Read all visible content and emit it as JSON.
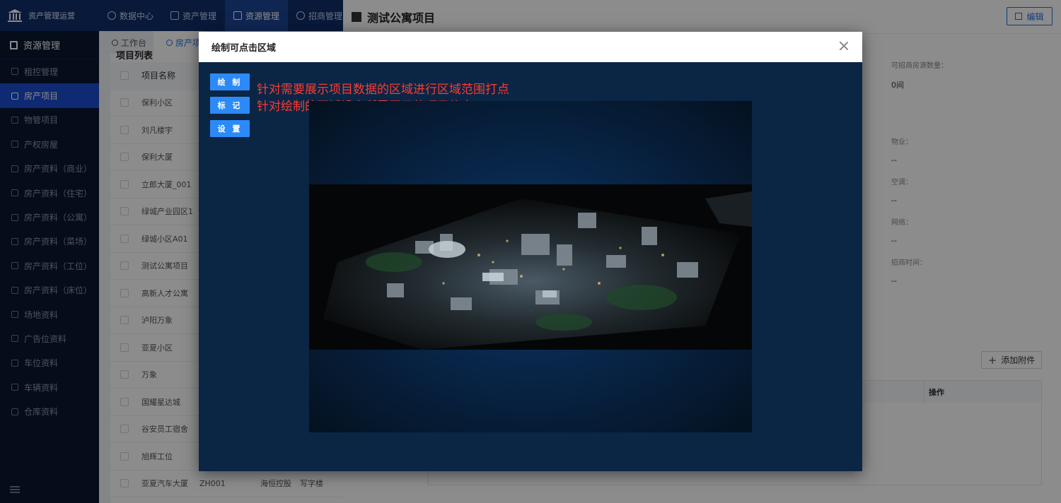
{
  "app": {
    "name": "资产管理运营"
  },
  "topnav": [
    {
      "label": "数据中心",
      "active": false
    },
    {
      "label": "资产管理",
      "active": false
    },
    {
      "label": "资源管理",
      "active": true
    },
    {
      "label": "招商管理",
      "active": false
    }
  ],
  "sidebar": {
    "header": "资源管理",
    "items": [
      {
        "label": "租控管理",
        "active": false
      },
      {
        "label": "房产项目",
        "active": true
      },
      {
        "label": "物管项目",
        "active": false
      },
      {
        "label": "产权房屋",
        "active": false
      },
      {
        "label": "房产资料（商业）",
        "active": false
      },
      {
        "label": "房产资料（住宅）",
        "active": false
      },
      {
        "label": "房产资料（公寓）",
        "active": false
      },
      {
        "label": "房产资料（菜场）",
        "active": false
      },
      {
        "label": "房产资料（工位）",
        "active": false
      },
      {
        "label": "房产资料（床位）",
        "active": false
      },
      {
        "label": "场地资料",
        "active": false
      },
      {
        "label": "广告位资料",
        "active": false
      },
      {
        "label": "车位资料",
        "active": false
      },
      {
        "label": "车辆资料",
        "active": false
      },
      {
        "label": "仓库资料",
        "active": false
      }
    ]
  },
  "tabs": [
    {
      "label": "工作台",
      "active": false
    },
    {
      "label": "房产项",
      "active": true
    }
  ],
  "list": {
    "title": "项目列表",
    "header": "项目名称",
    "rows": [
      {
        "name": "保利小区"
      },
      {
        "name": "刘凡楼宇"
      },
      {
        "name": "保利大厦"
      },
      {
        "name": "立郎大厦_001"
      },
      {
        "name": "绿城产业园区1"
      },
      {
        "name": "绿城小区A01"
      },
      {
        "name": "测试公寓项目"
      },
      {
        "name": "高新人才公寓"
      },
      {
        "name": "泸阳万象"
      },
      {
        "name": "亚夏小区"
      },
      {
        "name": "万象"
      },
      {
        "name": "国耀星达城"
      },
      {
        "name": "谷安员工宿舍"
      },
      {
        "name": "旭辉工位"
      },
      {
        "name": "亚夏汽车大厦",
        "code": "ZH001",
        "org": "海恒控股",
        "type": "写字楼"
      }
    ]
  },
  "detail": {
    "title": "测试公寓项目",
    "edit_label": "编辑",
    "fields": [
      {
        "label": "可招商房源数量：",
        "value": "0间"
      },
      {
        "label": "物业：",
        "value": "--"
      },
      {
        "label": "空调：",
        "value": "--"
      },
      {
        "label": "网络：",
        "value": "--"
      },
      {
        "label": "招商时间：",
        "value": "--"
      }
    ],
    "attach_label": "添加附件",
    "op_col": "操作"
  },
  "modal": {
    "title": "绘制可点击区域",
    "buttons": [
      "绘 制",
      "标 记",
      "设 置"
    ],
    "notes": [
      "针对需要展示项目数据的区域进行区域范围打点",
      "针对绘制的区域设定所需展示的项目信息"
    ]
  }
}
